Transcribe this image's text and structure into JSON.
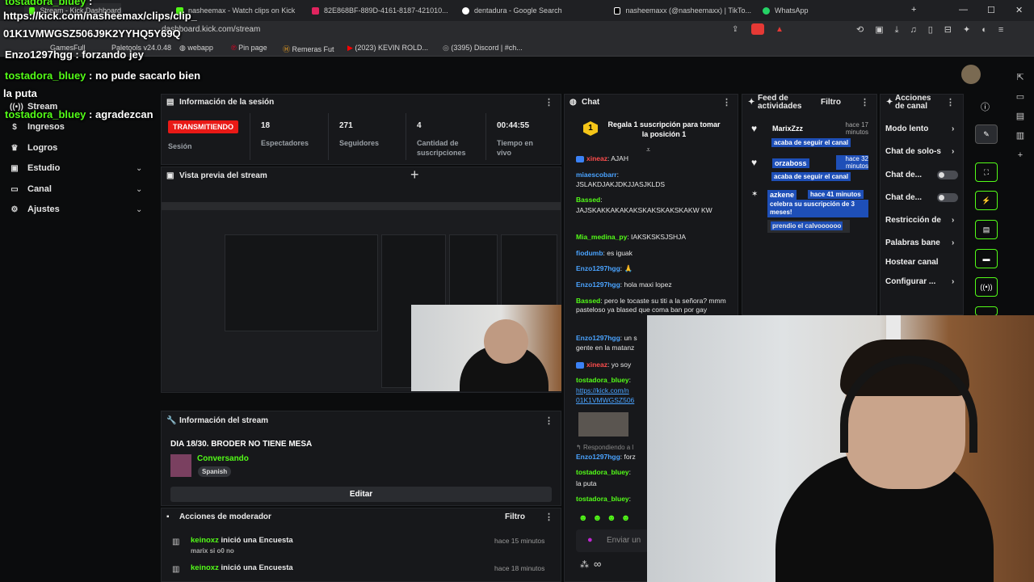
{
  "browser": {
    "tabs": [
      {
        "label": "Stream - Kick Dashboard",
        "color": "#53fc18"
      },
      {
        "label": "nasheemax - Watch clips on Kick",
        "color": "#53fc18"
      },
      {
        "label": "82E868BF-889D-4161-8187-421010...",
        "color": "#e0245e"
      },
      {
        "label": "dentadura - Google Search",
        "color": "#ffffff"
      },
      {
        "label": "nasheemaxx (@nasheemaxx) | TikTo...",
        "color": "#ffffff"
      },
      {
        "label": "WhatsApp",
        "color": "#25d366"
      }
    ],
    "new_tab": "+",
    "minimize": "—",
    "maximize": "☐",
    "close": "✕",
    "url": "dashboard.kick.com/stream",
    "bookmarks": [
      "GamesFull",
      "Paletools v24.0.48",
      "webapp",
      "Pin page",
      "Remeras Fut",
      "(2023) KEVIN ROLD...",
      "(3395) Discord | #ch..."
    ]
  },
  "overlay_chat": [
    {
      "user": "tostadora_bluey",
      "sep": " :",
      "text": "",
      "user_color": "green"
    },
    {
      "user": "",
      "sep": "",
      "text": "https://kick.com/nasheemax/clips/clip_",
      "user_color": "green"
    },
    {
      "user": "",
      "sep": "",
      "text": "01K1VMWGSZ506J9K2YYHQ5Y69Q",
      "user_color": "green"
    },
    {
      "user": "Enzo1297hgg",
      "sep": " :",
      "text": " forzando jey",
      "user_color": "green"
    },
    {
      "user": "tostadora_bluey",
      "sep": " :",
      "text": " no pude sacarlo bien",
      "user_color": "green"
    },
    {
      "user": "",
      "sep": "",
      "text": "la puta",
      "user_color": "green"
    },
    {
      "user": "tostadora_bluey",
      "sep": " :",
      "text": " agradezcan",
      "user_color": "green"
    }
  ],
  "sidebar": {
    "items": [
      {
        "label": "Stream",
        "icon": "broadcast-icon",
        "glyph": "((•))",
        "chevron": false
      },
      {
        "label": "Ingresos",
        "icon": "money-icon",
        "glyph": "$",
        "chevron": false
      },
      {
        "label": "Logros",
        "icon": "trophy-icon",
        "glyph": "🏆",
        "chevron": false
      },
      {
        "label": "Estudio",
        "icon": "studio-icon",
        "glyph": "▣",
        "chevron": true
      },
      {
        "label": "Canal",
        "icon": "channel-icon",
        "glyph": "▭",
        "chevron": true
      },
      {
        "label": "Ajustes",
        "icon": "gear-icon",
        "glyph": "⚙",
        "chevron": true
      }
    ]
  },
  "session": {
    "title": "Información de la sesión",
    "live_badge": "TRANSMITIENDO",
    "session_label": "Sesión",
    "stats": [
      {
        "value": "18",
        "label": "Espectadores"
      },
      {
        "value": "271",
        "label": "Seguidores"
      },
      {
        "value": "4",
        "label": "Cantidad de suscripciones"
      },
      {
        "value": "00:44:55",
        "label": "Tiempo en vivo"
      }
    ]
  },
  "preview": {
    "title": "Vista previa del stream"
  },
  "stream_info": {
    "title": "Información del stream",
    "stream_title": "DIA 18/30. BRODER NO TIENE MESA",
    "category": "Conversando",
    "language": "Spanish",
    "edit_label": "Editar"
  },
  "mod_actions": {
    "title": "Acciones de moderador",
    "filter": "Filtro",
    "items": [
      {
        "user": "keinoxz",
        "action": "inició una Encuesta",
        "time": "hace 15 minutos",
        "sub": "marix si o0 no"
      },
      {
        "user": "keinoxz",
        "action": "inició una Encuesta",
        "time": "hace 18 minutos",
        "sub": ""
      }
    ]
  },
  "chat": {
    "title": "Chat",
    "gift_text": "Regala 1 suscripción para tomar la posición 1",
    "gift_rank": "1",
    "messages": [
      {
        "user": "xineaz",
        "text": ": AJAH",
        "color": "red",
        "badge": true
      },
      {
        "user": "miaescobarr",
        "text": ":",
        "color": "blue",
        "badge": false
      },
      {
        "user": "",
        "text": "JSLAKDJAKJDKJJASJKLDS",
        "color": "",
        "badge": false
      },
      {
        "user": "Bassed",
        "text": ":",
        "color": "green",
        "badge": true
      },
      {
        "user": "",
        "text": "JAJSKAKKAKAKAKSKAKSKAKSKAKW KW",
        "color": "",
        "badge": false
      },
      {
        "user": "Mia_medina_py",
        "text": ": IAKSKSKSJSHJA",
        "color": "green",
        "badge": false
      },
      {
        "user": "fiodumb",
        "text": ": es iguak",
        "color": "blue",
        "badge": false
      },
      {
        "user": "Enzo1297hgg",
        "text": ": 🙏",
        "color": "blue",
        "badge": false
      },
      {
        "user": "Enzo1297hgg",
        "text": ": hola maxi lopez",
        "color": "blue",
        "badge": false
      },
      {
        "user": "Bassed",
        "text": ": pero le tocaste su titi a la señora? mmm pasteloso ya blased que coma ban por gay",
        "color": "green",
        "badge": false
      },
      {
        "user": "Enzo1297hgg",
        "text": ": un s",
        "color": "blue",
        "badge": false
      },
      {
        "user": "",
        "text": "gente en la matanz",
        "color": "",
        "badge": false
      },
      {
        "user": "xineaz",
        "text": ": yo soy",
        "color": "red",
        "badge": true
      },
      {
        "user": "tostadora_bluey",
        "text": ":",
        "color": "green",
        "badge": false
      },
      {
        "user": "",
        "text": "https://kick.com/n",
        "color": "link",
        "badge": false
      },
      {
        "user": "",
        "text": "01K1VMWGSZ506",
        "color": "link",
        "badge": false
      }
    ],
    "replying": "Respondiendo a l",
    "late_messages": [
      {
        "user": "Enzo1297hgg",
        "text": ": forz",
        "color": "blue"
      },
      {
        "user": "tostadora_bluey",
        "text": ":",
        "color": "green"
      },
      {
        "user": "",
        "text": "la puta",
        "color": ""
      },
      {
        "user": "tostadora_bluey",
        "text": ":",
        "color": "green"
      }
    ],
    "input_placeholder": "Enviar un",
    "infinity": "∞"
  },
  "feed": {
    "title": "Feed de actividades",
    "filter": "Filtro",
    "items": [
      {
        "user": "MarixZzz",
        "time": "hace 17 minutos",
        "message": "acaba de seguir el canal",
        "icon": "heart-icon"
      },
      {
        "user": "orzaboss",
        "time": "hace 32 minutos",
        "message": "acaba de seguir el canal",
        "icon": "heart-icon"
      },
      {
        "user": "azkene",
        "time": "hace 41 minutos",
        "message": "celebra su suscripción de 3 meses!",
        "extra": "prendio el calvoooooo",
        "icon": "star-icon"
      }
    ]
  },
  "channel_actions": {
    "title": "Acciones de canal",
    "items": [
      {
        "label": "Modo lento",
        "type": "arrow"
      },
      {
        "label": "Chat de solo-s",
        "type": "arrow"
      },
      {
        "label": "Chat de...",
        "type": "toggle"
      },
      {
        "label": "Chat de...",
        "type": "toggle"
      },
      {
        "label": "Restricción de",
        "type": "arrow"
      },
      {
        "label": "Palabras bane",
        "type": "arrow"
      },
      {
        "label": "Hostear canal",
        "type": "none"
      },
      {
        "label": "Configurar ...",
        "type": "arrow"
      }
    ]
  },
  "colors": {
    "accent": "#53fc18",
    "live": "#e91916",
    "link_blue": "#4aa3ff",
    "feed_blue": "#1e4fb8"
  }
}
